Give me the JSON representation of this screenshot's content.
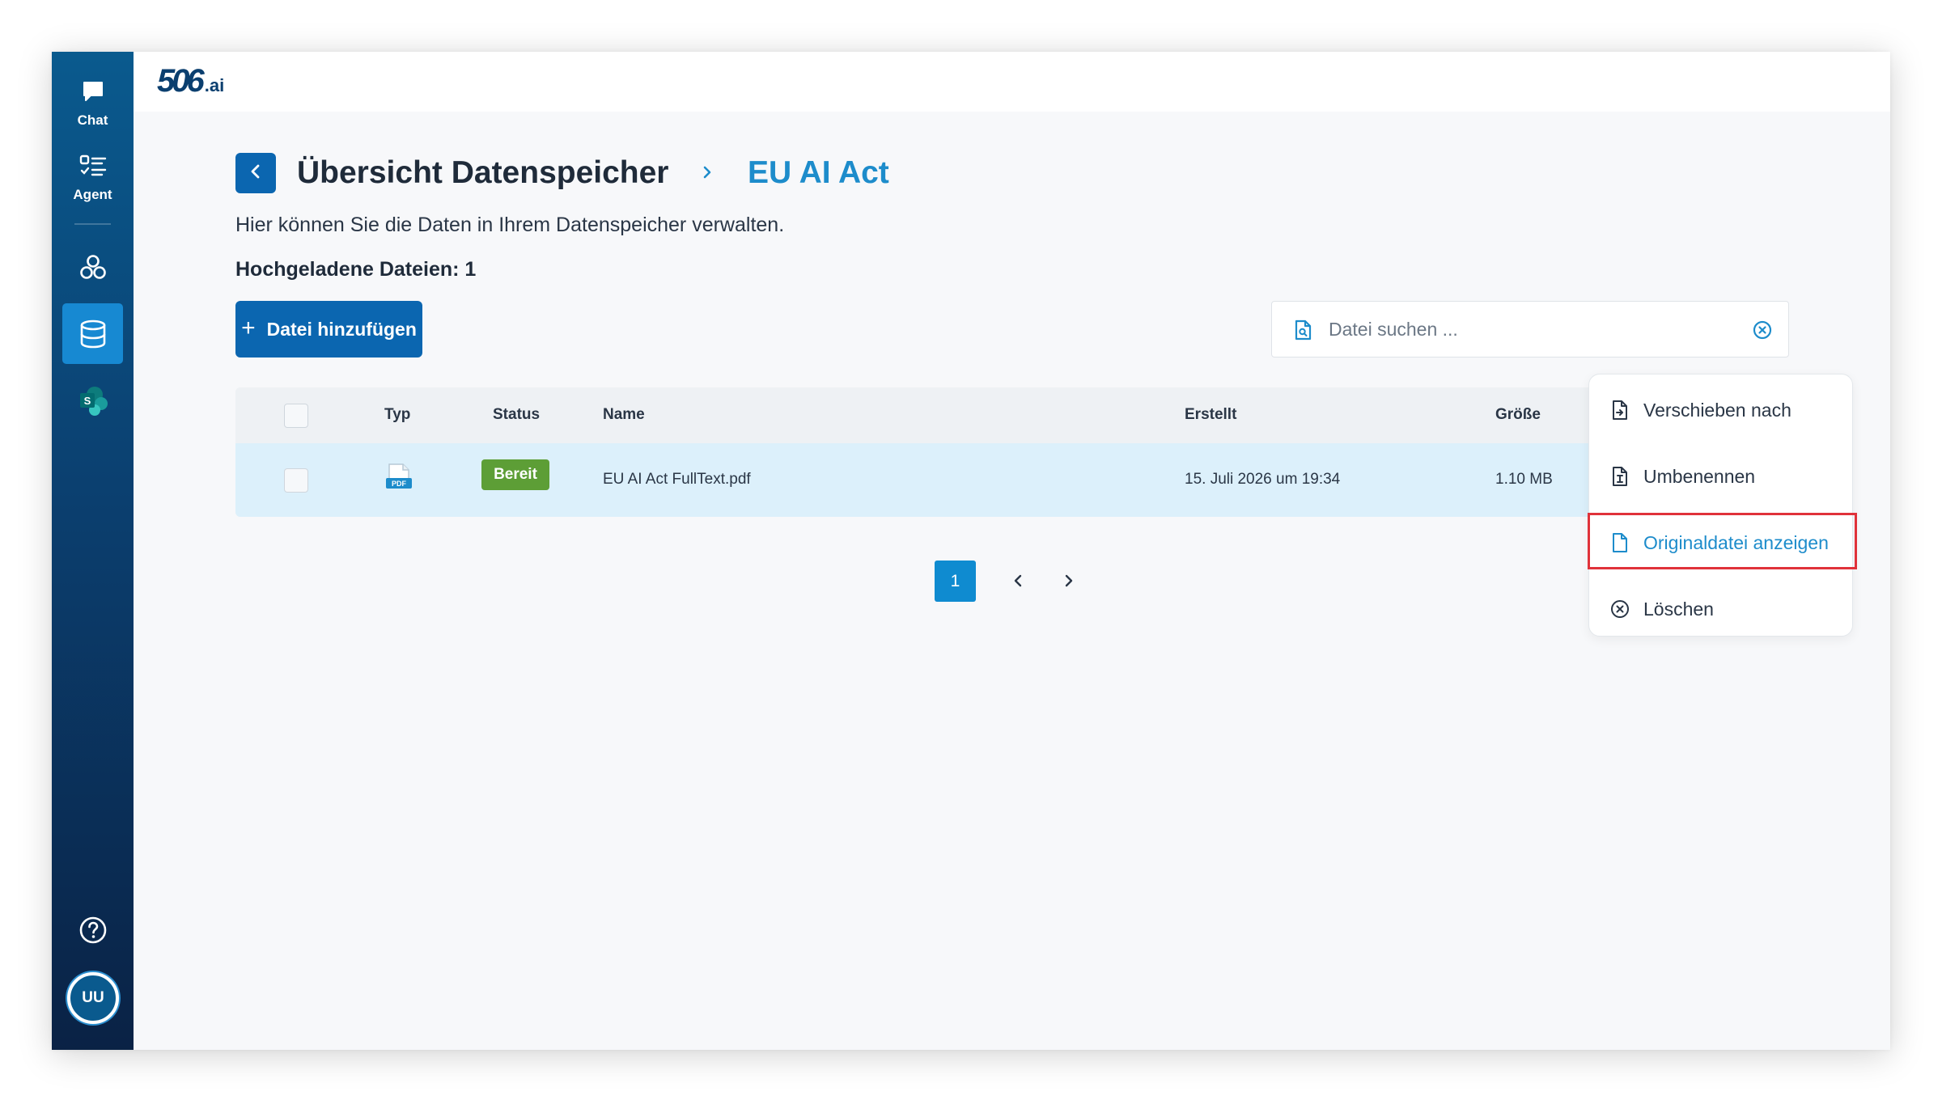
{
  "sidebar": {
    "items": [
      {
        "label": "Chat",
        "icon": "chat-bubble-icon"
      },
      {
        "label": "Agent",
        "icon": "checklist-icon"
      },
      {
        "label": "",
        "icon": "nodes-icon"
      },
      {
        "label": "",
        "icon": "database-icon",
        "active": true
      },
      {
        "label": "",
        "icon": "sharepoint-icon"
      }
    ],
    "help_icon": "question-circle-icon",
    "avatar_initials": "UU"
  },
  "logo": {
    "main": "506",
    "suffix": ".ai"
  },
  "header": {
    "title": "Übersicht Datenspeicher",
    "breadcrumb_current": "EU AI Act",
    "subtitle": "Hier können Sie die Daten in Ihrem Datenspeicher verwalten.",
    "uploaded_count": "Hochgeladene Dateien: 1"
  },
  "toolbar": {
    "add_label": "Datei hinzufügen",
    "add_icon": "+"
  },
  "search": {
    "placeholder": "Datei suchen ..."
  },
  "table": {
    "columns": {
      "type": "Typ",
      "status": "Status",
      "name": "Name",
      "created": "Erstellt",
      "size": "Größe"
    },
    "rows": [
      {
        "type_icon": "pdf-file-icon",
        "type_label": "PDF",
        "status": "Bereit",
        "name": "EU AI Act FullText.pdf",
        "created": "15. Juli 2026 um 19:34",
        "size": "1.10 MB"
      }
    ]
  },
  "pagination": {
    "current_page": "1"
  },
  "context_menu": {
    "items": [
      {
        "label": "Verschieben nach"
      },
      {
        "label": "Umbenennen"
      },
      {
        "label": "Originaldatei anzeigen",
        "highlighted": true
      },
      {
        "label": "Löschen"
      }
    ]
  },
  "colors": {
    "primary": "#0b66b0",
    "accent": "#1d8ccb",
    "status_ready": "#5d9e36",
    "highlight_border": "#e0323a",
    "row_selected": "#dcf0fb"
  }
}
